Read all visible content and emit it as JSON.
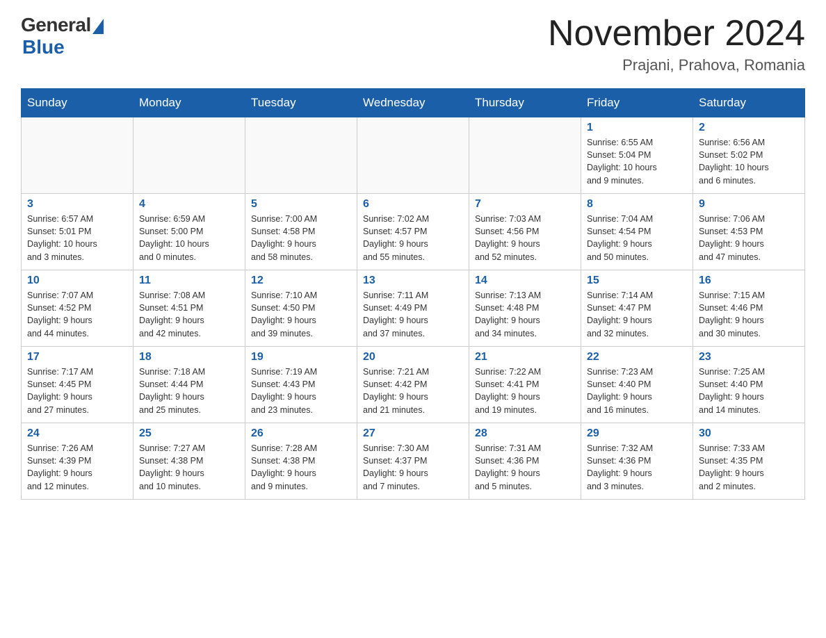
{
  "logo": {
    "general": "General",
    "blue": "Blue"
  },
  "title": "November 2024",
  "location": "Prajani, Prahova, Romania",
  "days_header": [
    "Sunday",
    "Monday",
    "Tuesday",
    "Wednesday",
    "Thursday",
    "Friday",
    "Saturday"
  ],
  "weeks": [
    [
      {
        "day": "",
        "info": ""
      },
      {
        "day": "",
        "info": ""
      },
      {
        "day": "",
        "info": ""
      },
      {
        "day": "",
        "info": ""
      },
      {
        "day": "",
        "info": ""
      },
      {
        "day": "1",
        "info": "Sunrise: 6:55 AM\nSunset: 5:04 PM\nDaylight: 10 hours\nand 9 minutes."
      },
      {
        "day": "2",
        "info": "Sunrise: 6:56 AM\nSunset: 5:02 PM\nDaylight: 10 hours\nand 6 minutes."
      }
    ],
    [
      {
        "day": "3",
        "info": "Sunrise: 6:57 AM\nSunset: 5:01 PM\nDaylight: 10 hours\nand 3 minutes."
      },
      {
        "day": "4",
        "info": "Sunrise: 6:59 AM\nSunset: 5:00 PM\nDaylight: 10 hours\nand 0 minutes."
      },
      {
        "day": "5",
        "info": "Sunrise: 7:00 AM\nSunset: 4:58 PM\nDaylight: 9 hours\nand 58 minutes."
      },
      {
        "day": "6",
        "info": "Sunrise: 7:02 AM\nSunset: 4:57 PM\nDaylight: 9 hours\nand 55 minutes."
      },
      {
        "day": "7",
        "info": "Sunrise: 7:03 AM\nSunset: 4:56 PM\nDaylight: 9 hours\nand 52 minutes."
      },
      {
        "day": "8",
        "info": "Sunrise: 7:04 AM\nSunset: 4:54 PM\nDaylight: 9 hours\nand 50 minutes."
      },
      {
        "day": "9",
        "info": "Sunrise: 7:06 AM\nSunset: 4:53 PM\nDaylight: 9 hours\nand 47 minutes."
      }
    ],
    [
      {
        "day": "10",
        "info": "Sunrise: 7:07 AM\nSunset: 4:52 PM\nDaylight: 9 hours\nand 44 minutes."
      },
      {
        "day": "11",
        "info": "Sunrise: 7:08 AM\nSunset: 4:51 PM\nDaylight: 9 hours\nand 42 minutes."
      },
      {
        "day": "12",
        "info": "Sunrise: 7:10 AM\nSunset: 4:50 PM\nDaylight: 9 hours\nand 39 minutes."
      },
      {
        "day": "13",
        "info": "Sunrise: 7:11 AM\nSunset: 4:49 PM\nDaylight: 9 hours\nand 37 minutes."
      },
      {
        "day": "14",
        "info": "Sunrise: 7:13 AM\nSunset: 4:48 PM\nDaylight: 9 hours\nand 34 minutes."
      },
      {
        "day": "15",
        "info": "Sunrise: 7:14 AM\nSunset: 4:47 PM\nDaylight: 9 hours\nand 32 minutes."
      },
      {
        "day": "16",
        "info": "Sunrise: 7:15 AM\nSunset: 4:46 PM\nDaylight: 9 hours\nand 30 minutes."
      }
    ],
    [
      {
        "day": "17",
        "info": "Sunrise: 7:17 AM\nSunset: 4:45 PM\nDaylight: 9 hours\nand 27 minutes."
      },
      {
        "day": "18",
        "info": "Sunrise: 7:18 AM\nSunset: 4:44 PM\nDaylight: 9 hours\nand 25 minutes."
      },
      {
        "day": "19",
        "info": "Sunrise: 7:19 AM\nSunset: 4:43 PM\nDaylight: 9 hours\nand 23 minutes."
      },
      {
        "day": "20",
        "info": "Sunrise: 7:21 AM\nSunset: 4:42 PM\nDaylight: 9 hours\nand 21 minutes."
      },
      {
        "day": "21",
        "info": "Sunrise: 7:22 AM\nSunset: 4:41 PM\nDaylight: 9 hours\nand 19 minutes."
      },
      {
        "day": "22",
        "info": "Sunrise: 7:23 AM\nSunset: 4:40 PM\nDaylight: 9 hours\nand 16 minutes."
      },
      {
        "day": "23",
        "info": "Sunrise: 7:25 AM\nSunset: 4:40 PM\nDaylight: 9 hours\nand 14 minutes."
      }
    ],
    [
      {
        "day": "24",
        "info": "Sunrise: 7:26 AM\nSunset: 4:39 PM\nDaylight: 9 hours\nand 12 minutes."
      },
      {
        "day": "25",
        "info": "Sunrise: 7:27 AM\nSunset: 4:38 PM\nDaylight: 9 hours\nand 10 minutes."
      },
      {
        "day": "26",
        "info": "Sunrise: 7:28 AM\nSunset: 4:38 PM\nDaylight: 9 hours\nand 9 minutes."
      },
      {
        "day": "27",
        "info": "Sunrise: 7:30 AM\nSunset: 4:37 PM\nDaylight: 9 hours\nand 7 minutes."
      },
      {
        "day": "28",
        "info": "Sunrise: 7:31 AM\nSunset: 4:36 PM\nDaylight: 9 hours\nand 5 minutes."
      },
      {
        "day": "29",
        "info": "Sunrise: 7:32 AM\nSunset: 4:36 PM\nDaylight: 9 hours\nand 3 minutes."
      },
      {
        "day": "30",
        "info": "Sunrise: 7:33 AM\nSunset: 4:35 PM\nDaylight: 9 hours\nand 2 minutes."
      }
    ]
  ]
}
